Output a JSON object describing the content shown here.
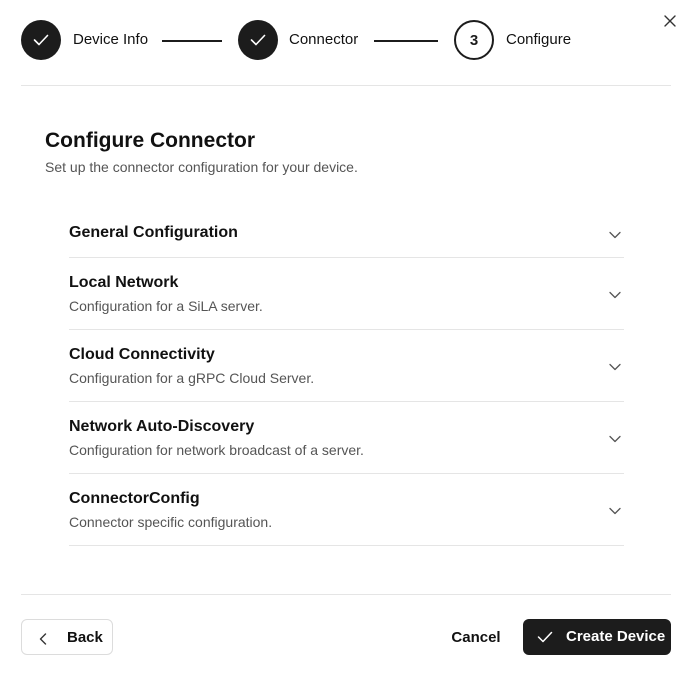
{
  "dialog": {
    "close_icon": "close-icon"
  },
  "stepper": {
    "steps": [
      {
        "label": "Device Info",
        "status": "complete",
        "icon": "check-icon"
      },
      {
        "label": "Connector",
        "status": "complete",
        "icon": "check-icon"
      },
      {
        "label": "Configure",
        "status": "current",
        "number": "3"
      }
    ]
  },
  "main": {
    "title": "Configure Connector",
    "subtitle": "Set up the connector configuration for your device.",
    "sections": [
      {
        "title": "General Configuration",
        "description": ""
      },
      {
        "title": "Local Network",
        "description": "Configuration for a SiLA server."
      },
      {
        "title": "Cloud Connectivity",
        "description": "Configuration for a gRPC Cloud Server."
      },
      {
        "title": "Network Auto-Discovery",
        "description": "Configuration for network broadcast of a server."
      },
      {
        "title": "ConnectorConfig",
        "description": "Connector specific configuration."
      }
    ]
  },
  "footer": {
    "back_label": "Back",
    "cancel_label": "Cancel",
    "create_label": "Create Device"
  },
  "colors": {
    "primary": "#1c1c1c",
    "divider": "#e5e5e5",
    "muted_text": "#555555"
  }
}
